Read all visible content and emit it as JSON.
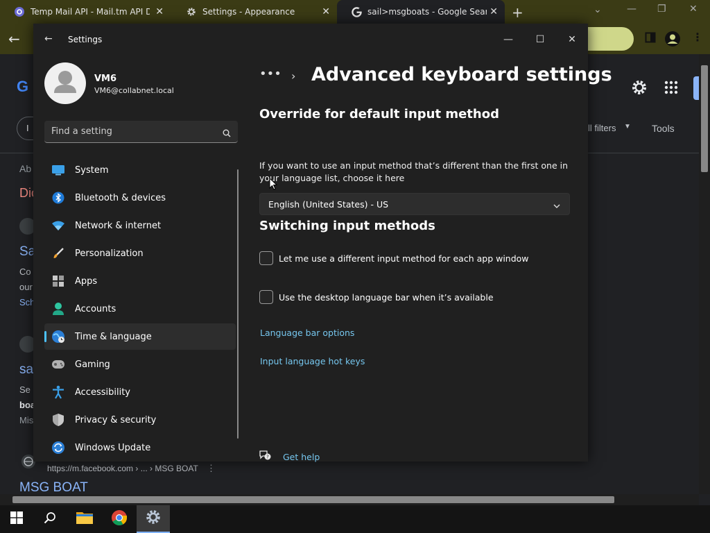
{
  "browser": {
    "tabs": [
      {
        "title": "Temp Mail API - Mail.tm API Documentation",
        "icon": "mailtm-icon"
      },
      {
        "title": "Settings - Appearance",
        "icon": "gear-icon"
      },
      {
        "title": "sail>msgboats - Google Search",
        "icon": "google-icon",
        "active": true
      }
    ]
  },
  "google_page": {
    "partial_text": [
      "Ab",
      "Dic",
      "Sa",
      "Co",
      "our",
      "Sch",
      "sa",
      "Se",
      "boa",
      "Mis",
      "I"
    ],
    "filters_label": "ll filters",
    "tools_label": "Tools",
    "result_url": "https://m.facebook.com › ... › MSG BOAT",
    "result_title": "MSG BOAT"
  },
  "settings": {
    "window_title": "Settings",
    "profile": {
      "name": "VM6",
      "email": "VM6@collabnet.local"
    },
    "search_placeholder": "Find a setting",
    "nav": [
      {
        "label": "System",
        "icon": "system-icon"
      },
      {
        "label": "Bluetooth & devices",
        "icon": "bluetooth-icon"
      },
      {
        "label": "Network & internet",
        "icon": "wifi-icon"
      },
      {
        "label": "Personalization",
        "icon": "brush-icon"
      },
      {
        "label": "Apps",
        "icon": "apps-icon"
      },
      {
        "label": "Accounts",
        "icon": "accounts-icon"
      },
      {
        "label": "Time & language",
        "icon": "globe-clock-icon",
        "selected": true
      },
      {
        "label": "Gaming",
        "icon": "gamepad-icon"
      },
      {
        "label": "Accessibility",
        "icon": "accessibility-icon"
      },
      {
        "label": "Privacy & security",
        "icon": "shield-icon"
      },
      {
        "label": "Windows Update",
        "icon": "update-icon"
      }
    ],
    "breadcrumb_more": "•••",
    "breadcrumb_chevron": "›",
    "page_title": "Advanced keyboard settings",
    "override": {
      "title": "Override for default input method",
      "description": "If you want to use an input method that’s different than the first one in your language list, choose it here",
      "selected": "English (United States) - US"
    },
    "switching": {
      "title": "Switching input methods",
      "options": [
        {
          "label": "Let me use a different input method for each app window",
          "checked": false
        },
        {
          "label": "Use the desktop language bar when it’s available",
          "checked": false
        }
      ]
    },
    "links": {
      "language_bar_options": "Language bar options",
      "input_language_hot_keys": "Input language hot keys"
    },
    "get_help": "Get help"
  }
}
